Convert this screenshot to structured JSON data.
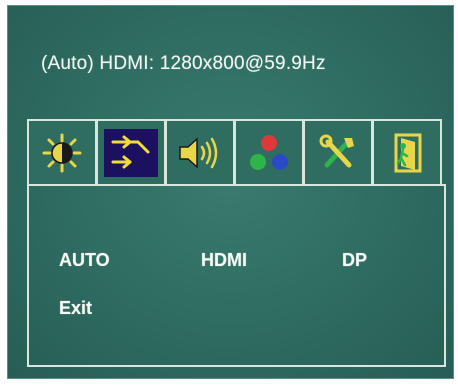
{
  "status": {
    "text": "(Auto) HDMI: 1280x800@59.9Hz"
  },
  "tabs": [
    {
      "icon": "brightness-contrast-icon",
      "active": false
    },
    {
      "icon": "input-source-icon",
      "active": true
    },
    {
      "icon": "speaker-volume-icon",
      "active": false
    },
    {
      "icon": "color-rgb-icon",
      "active": false
    },
    {
      "icon": "tools-settings-icon",
      "active": false
    },
    {
      "icon": "exit-door-icon",
      "active": false
    }
  ],
  "input_menu": {
    "options": [
      "AUTO",
      "HDMI",
      "DP"
    ],
    "exit_label": "Exit"
  },
  "colors": {
    "osd_background": "#2f6f63",
    "border": "#d7e7e0",
    "active_tab": "#1b1160",
    "text": "#f6faf7"
  }
}
